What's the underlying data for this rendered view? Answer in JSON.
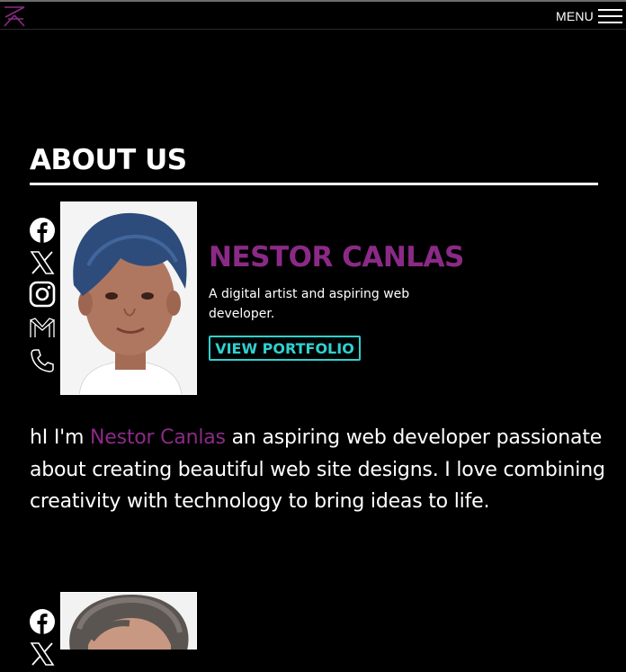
{
  "nav": {
    "logo_icon": "brand-logo-icon",
    "menu_label": "MENU",
    "menu_icon": "hamburger-icon"
  },
  "about": {
    "title": "ABOUT US"
  },
  "members": [
    {
      "name": "NESTOR CANLAS",
      "role": "A digital artist and aspiring web developer.",
      "portfolio_label": "VIEW PORTFOLIO",
      "bio_prefix": "hI I'm ",
      "bio_highlight": "Nestor Canlas",
      "bio_suffix": " an aspiring web developer passionate about creating beautiful web site designs. I love combining creativity with technology to bring ideas to life.",
      "social_icons": [
        "facebook-icon",
        "x-icon",
        "instagram-icon",
        "gmail-icon",
        "phone-icon"
      ]
    },
    {
      "name": "",
      "social_icons": [
        "facebook-icon",
        "x-icon"
      ]
    }
  ],
  "colors": {
    "background": "#000000",
    "accent_magenta": "#8b2a86",
    "accent_cyan": "#2fd1d1",
    "text": "#ffffff"
  }
}
